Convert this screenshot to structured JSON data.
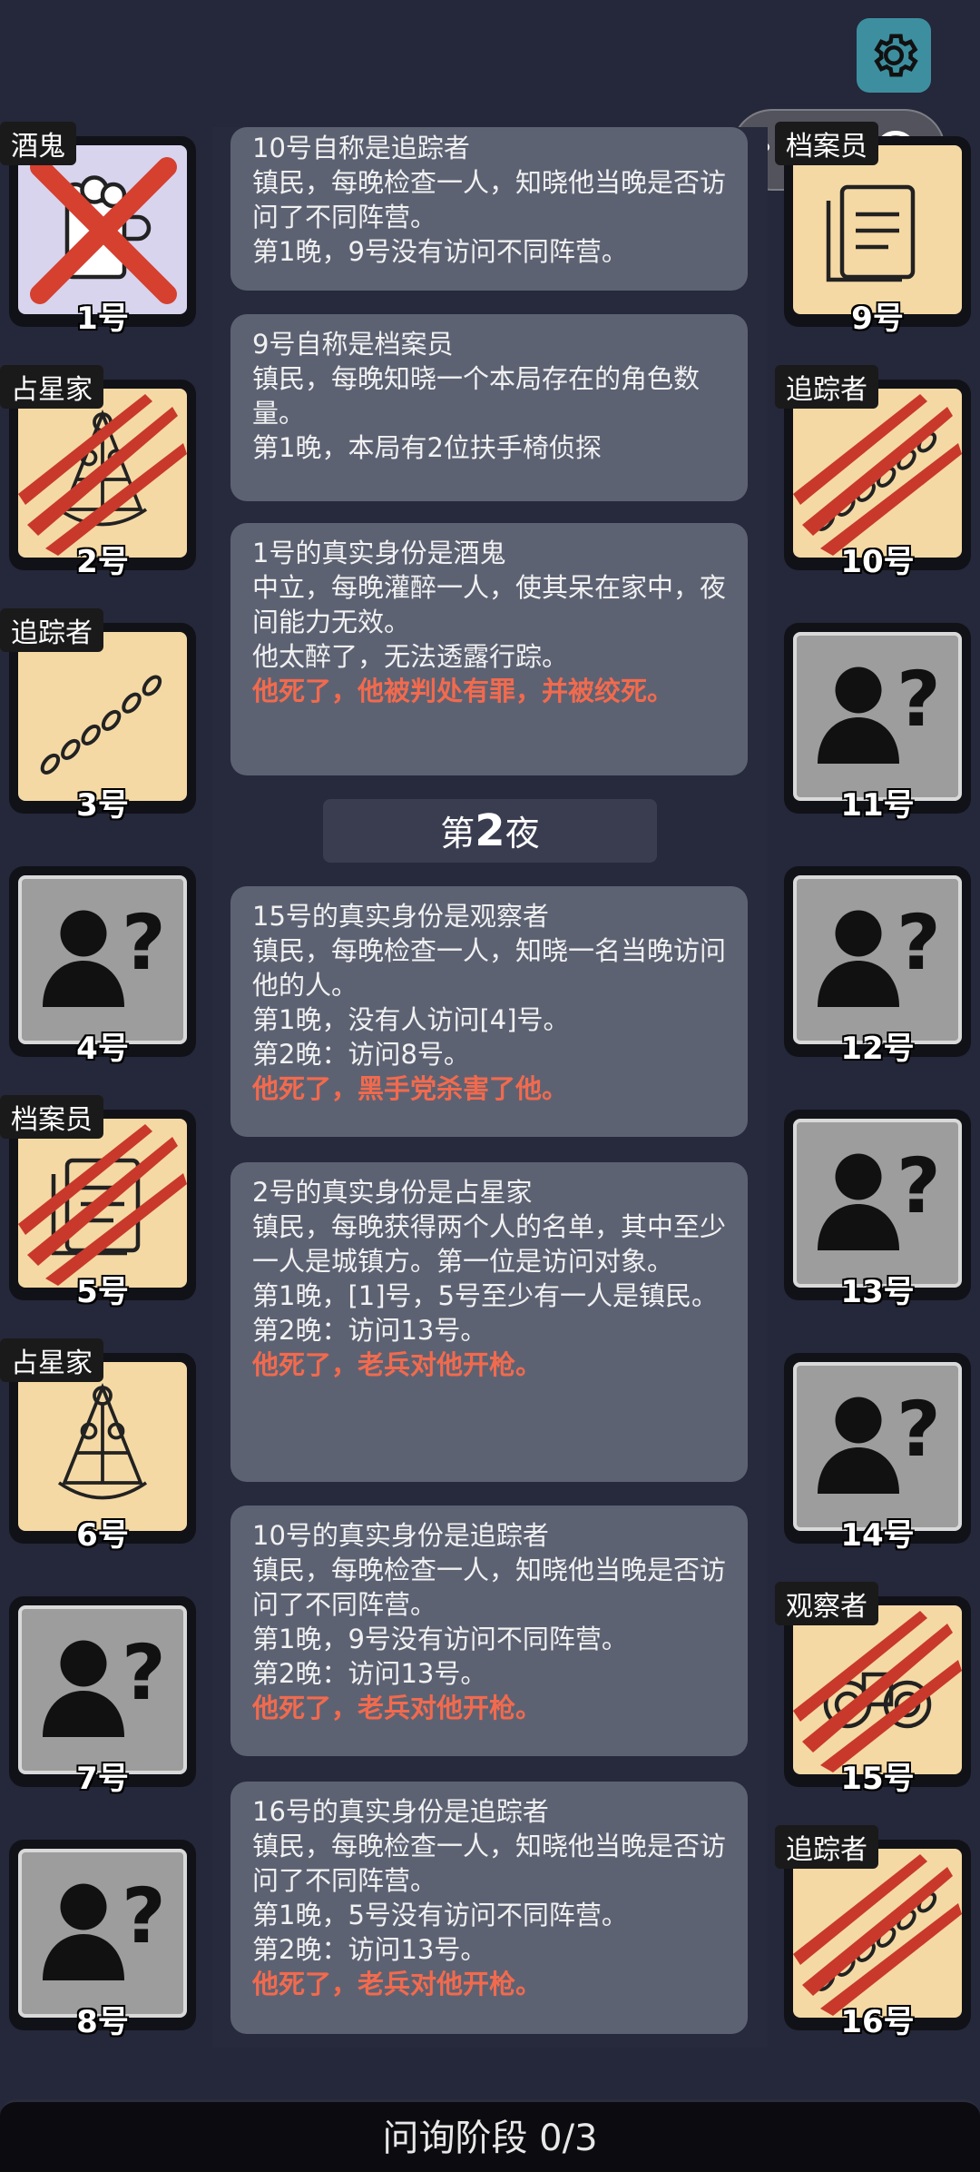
{
  "header": {
    "settings_icon": "gear-icon",
    "capsule_icons": [
      "more-dots-icon",
      "close-target-icon"
    ]
  },
  "players_left": [
    {
      "number": "1号",
      "role_tag": "酒鬼",
      "state": "crossed",
      "icon": "beer-mug-icon"
    },
    {
      "number": "2号",
      "role_tag": "占星家",
      "state": "clawed",
      "icon": "sextant-icon"
    },
    {
      "number": "3号",
      "role_tag": "追踪者",
      "state": "alive",
      "icon": "footprints-icon"
    },
    {
      "number": "4号",
      "role_tag": "",
      "state": "unknown",
      "icon": "unknown-person-icon"
    },
    {
      "number": "5号",
      "role_tag": "档案员",
      "state": "clawed",
      "icon": "documents-icon"
    },
    {
      "number": "6号",
      "role_tag": "占星家",
      "state": "alive",
      "icon": "sextant-icon"
    },
    {
      "number": "7号",
      "role_tag": "",
      "state": "unknown",
      "icon": "unknown-person-icon"
    },
    {
      "number": "8号",
      "role_tag": "",
      "state": "unknown",
      "icon": "unknown-person-icon"
    }
  ],
  "players_right": [
    {
      "number": "9号",
      "role_tag": "档案员",
      "state": "alive",
      "icon": "documents-icon"
    },
    {
      "number": "10号",
      "role_tag": "追踪者",
      "state": "clawed",
      "icon": "footprints-icon"
    },
    {
      "number": "11号",
      "role_tag": "",
      "state": "unknown",
      "icon": "unknown-person-icon"
    },
    {
      "number": "12号",
      "role_tag": "",
      "state": "unknown",
      "icon": "unknown-person-icon"
    },
    {
      "number": "13号",
      "role_tag": "",
      "state": "unknown",
      "icon": "unknown-person-icon"
    },
    {
      "number": "14号",
      "role_tag": "",
      "state": "unknown",
      "icon": "unknown-person-icon"
    },
    {
      "number": "15号",
      "role_tag": "观察者",
      "state": "clawed",
      "icon": "binoculars-icon"
    },
    {
      "number": "16号",
      "role_tag": "追踪者",
      "state": "clawed",
      "icon": "footprints-icon"
    }
  ],
  "log": {
    "messages_before": [
      {
        "lines": [
          "10号自称是追踪者",
          "镇民，每晚检查一人，知晓他当晚是否访问了不同阵营。",
          "第1晚，9号没有访问不同阵营。"
        ],
        "red": ""
      },
      {
        "lines": [
          "9号自称是档案员",
          "镇民，每晚知晓一个本局存在的角色数量。",
          "第1晚，本局有2位扶手椅侦探"
        ],
        "red": ""
      },
      {
        "lines": [
          "1号的真实身份是酒鬼",
          "中立，每晚灌醉一人，使其呆在家中，夜间能力无效。",
          "他太醉了，无法透露行踪。"
        ],
        "red": "他死了，他被判处有罪，并被绞死。"
      }
    ],
    "night_prefix": "第",
    "night_number": "2",
    "night_suffix": "夜",
    "messages_after": [
      {
        "lines": [
          "15号的真实身份是观察者",
          "镇民，每晚检查一人，知晓一名当晚访问他的人。",
          "第1晚，没有人访问[4]号。",
          "第2晚：访问8号。"
        ],
        "red": "他死了，黑手党杀害了他。"
      },
      {
        "lines": [
          "2号的真实身份是占星家",
          "镇民，每晚获得两个人的名单，其中至少一人是城镇方。第一位是访问对象。",
          "第1晚，[1]号，5号至少有一人是镇民。",
          "第2晚：访问13号。"
        ],
        "red": "他死了，老兵对他开枪。"
      },
      {
        "lines": [
          "10号的真实身份是追踪者",
          "镇民，每晚检查一人，知晓他当晚是否访问了不同阵营。",
          "第1晚，9号没有访问不同阵营。",
          "第2晚：访问13号。"
        ],
        "red": "他死了，老兵对他开枪。"
      },
      {
        "lines": [
          "16号的真实身份是追踪者",
          "镇民，每晚检查一人，知晓他当晚是否访问了不同阵营。",
          "第1晚，5号没有访问不同阵营。",
          "第2晚：访问13号。"
        ],
        "red": "他死了，老兵对他开枪。"
      }
    ]
  },
  "footer": {
    "phase_label": "问询阶段 0/3"
  },
  "colors": {
    "background": "#25273a",
    "message_bg": "#5d6273",
    "death_text": "#f26a4d",
    "card_cream": "#f5d9a4",
    "card_unknown": "#9d9d9d",
    "claw_red": "#c8392b"
  }
}
